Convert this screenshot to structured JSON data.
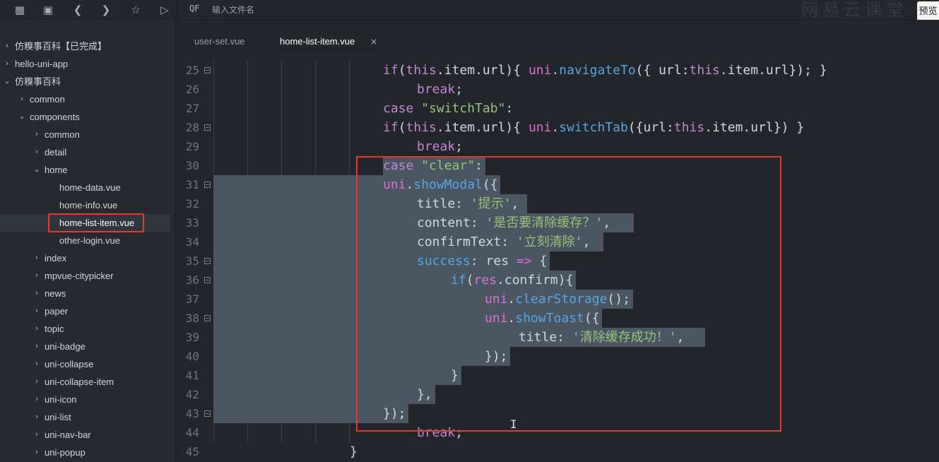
{
  "toolbar": {
    "search_placeholder": "输入文件名",
    "search_prefix": "QF",
    "watermark": "网易云课堂",
    "preview_label": "预览"
  },
  "sidebar": {
    "items": [
      {
        "label": "仿糗事百科【已完成】",
        "expanded": false
      },
      {
        "label": "hello-uni-app",
        "expanded": false
      },
      {
        "label": "仿糗事百科",
        "expanded": true
      },
      {
        "label": "common",
        "expanded": false
      },
      {
        "label": "components",
        "expanded": true
      },
      {
        "label": "common",
        "expanded": false
      },
      {
        "label": "detail",
        "expanded": false
      },
      {
        "label": "home",
        "expanded": true
      },
      {
        "label": "home-data.vue"
      },
      {
        "label": "home-info.vue"
      },
      {
        "label": "home-list-item.vue",
        "selected": true
      },
      {
        "label": "other-login.vue"
      },
      {
        "label": "index",
        "expanded": false
      },
      {
        "label": "mpvue-citypicker",
        "expanded": false
      },
      {
        "label": "news",
        "expanded": false
      },
      {
        "label": "paper",
        "expanded": false
      },
      {
        "label": "topic",
        "expanded": false
      },
      {
        "label": "uni-badge",
        "expanded": false
      },
      {
        "label": "uni-collapse",
        "expanded": false
      },
      {
        "label": "uni-collapse-item",
        "expanded": false
      },
      {
        "label": "uni-icon",
        "expanded": false
      },
      {
        "label": "uni-list",
        "expanded": false
      },
      {
        "label": "uni-nav-bar",
        "expanded": false
      },
      {
        "label": "uni-popup",
        "expanded": false
      }
    ]
  },
  "tabs": [
    {
      "label": "user-set.vue",
      "active": false
    },
    {
      "label": "home-list-item.vue",
      "active": true,
      "close": "×"
    }
  ],
  "editor": {
    "line_numbers": [
      "25",
      "26",
      "27",
      "28",
      "29",
      "30",
      "31",
      "32",
      "33",
      "34",
      "35",
      "36",
      "37",
      "38",
      "39",
      "40",
      "41",
      "42",
      "43",
      "44",
      "45"
    ],
    "folds": [
      "25",
      "28",
      "31",
      "35",
      "36",
      "38",
      "43"
    ],
    "lines": [
      [
        [
          "t",
          "if"
        ],
        [
          "p",
          "("
        ],
        [
          "t",
          "this"
        ],
        [
          "p",
          ".item.url){ "
        ],
        [
          "o",
          "uni"
        ],
        [
          "p",
          "."
        ],
        [
          "f",
          "navigateTo"
        ],
        [
          "p",
          "({ url:"
        ],
        [
          "t",
          "this"
        ],
        [
          "p",
          ".item.url}); }"
        ]
      ],
      [
        [
          "k",
          "break"
        ],
        [
          "p",
          ";"
        ]
      ],
      [
        [
          "k",
          "case"
        ],
        [
          "p",
          " "
        ],
        [
          "s",
          "\"switchTab\""
        ],
        [
          "p",
          ":"
        ]
      ],
      [
        [
          "t",
          "if"
        ],
        [
          "p",
          "("
        ],
        [
          "t",
          "this"
        ],
        [
          "p",
          ".item.url){ "
        ],
        [
          "o",
          "uni"
        ],
        [
          "p",
          "."
        ],
        [
          "f",
          "switchTab"
        ],
        [
          "p",
          "({url:"
        ],
        [
          "t",
          "this"
        ],
        [
          "p",
          ".item.url}) }"
        ]
      ],
      [
        [
          "k",
          "break"
        ],
        [
          "p",
          ";"
        ]
      ],
      [
        [
          "k",
          "case"
        ],
        [
          "p",
          " "
        ],
        [
          "s",
          "\"clear\""
        ],
        [
          "p",
          ":"
        ]
      ],
      [
        [
          "o",
          "uni"
        ],
        [
          "p",
          "."
        ],
        [
          "f",
          "showModal"
        ],
        [
          "p",
          "({"
        ]
      ],
      [
        [
          "p",
          "title: "
        ],
        [
          "s",
          "'提示'"
        ],
        [
          "p",
          ","
        ]
      ],
      [
        [
          "p",
          "content: "
        ],
        [
          "s",
          "'是否要清除缓存？'"
        ],
        [
          "p",
          ","
        ]
      ],
      [
        [
          "p",
          "confirmText: "
        ],
        [
          "s",
          "'立刻清除'"
        ],
        [
          "p",
          ","
        ]
      ],
      [
        [
          "f",
          "success"
        ],
        [
          "p",
          ": res "
        ],
        [
          "o",
          "=>"
        ],
        [
          "p",
          " {"
        ]
      ],
      [
        [
          "f",
          "if"
        ],
        [
          "p",
          "("
        ],
        [
          "o",
          "res"
        ],
        [
          "p",
          ".confirm){"
        ]
      ],
      [
        [
          "o",
          "uni"
        ],
        [
          "p",
          "."
        ],
        [
          "f",
          "clearStorage"
        ],
        [
          "p",
          "();"
        ]
      ],
      [
        [
          "o",
          "uni"
        ],
        [
          "p",
          "."
        ],
        [
          "f",
          "showToast"
        ],
        [
          "p",
          "({"
        ]
      ],
      [
        [
          "p",
          "title: "
        ],
        [
          "s",
          "'清除缓存成功！'"
        ],
        [
          "p",
          ","
        ]
      ],
      [
        [
          "p",
          "});"
        ]
      ],
      [
        [
          "p",
          "}"
        ]
      ],
      [
        [
          "p",
          "},"
        ]
      ],
      [
        [
          "p",
          "});"
        ]
      ],
      [
        [
          "k",
          "break"
        ],
        [
          "p",
          ";"
        ]
      ],
      [
        [
          "p",
          "}"
        ]
      ]
    ]
  }
}
